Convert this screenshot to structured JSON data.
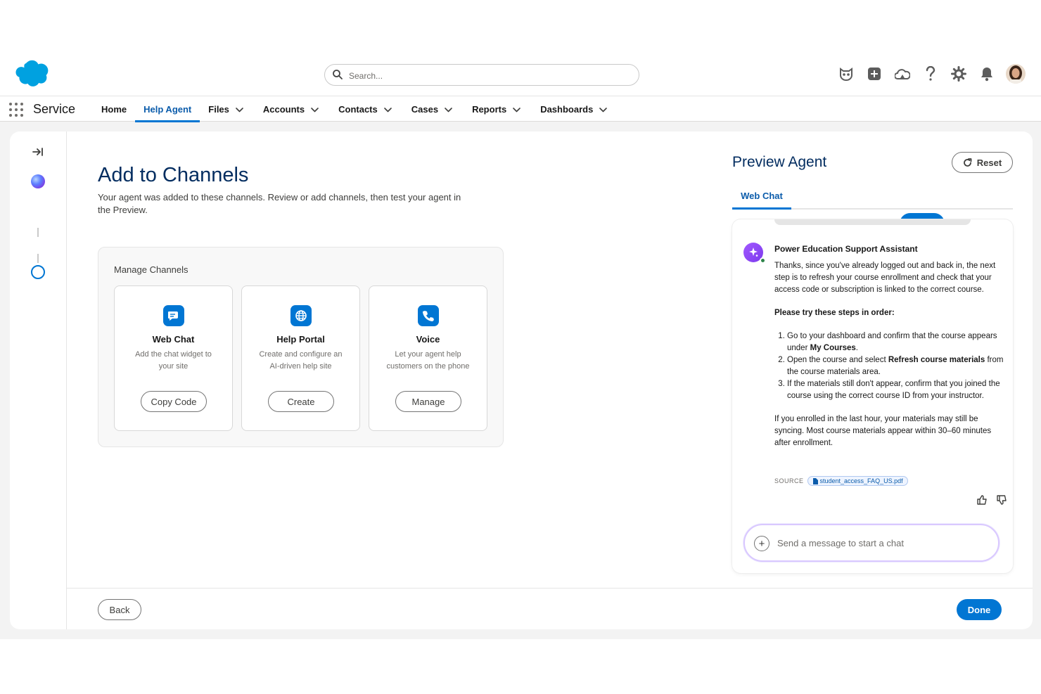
{
  "header": {
    "search_placeholder": "Search...",
    "icons": [
      "agentforce-icon",
      "add-icon",
      "trailhead-icon",
      "help-icon",
      "setup-gear-icon",
      "notifications-bell-icon",
      "user-avatar"
    ]
  },
  "nav": {
    "app_name": "Service",
    "items": [
      {
        "label": "Home",
        "dropdown": false,
        "active": false
      },
      {
        "label": "Help Agent",
        "dropdown": false,
        "active": true
      },
      {
        "label": "Files",
        "dropdown": true,
        "active": false
      },
      {
        "label": "Accounts",
        "dropdown": true,
        "active": false
      },
      {
        "label": "Contacts",
        "dropdown": true,
        "active": false
      },
      {
        "label": "Cases",
        "dropdown": true,
        "active": false
      },
      {
        "label": "Reports",
        "dropdown": true,
        "active": false
      },
      {
        "label": "Dashboards",
        "dropdown": true,
        "active": false
      }
    ]
  },
  "main": {
    "title": "Add to Channels",
    "description": "Your agent was added to these channels. Review or add channels, then test your agent in the Preview.",
    "manage_title": "Manage Channels",
    "channels": [
      {
        "name": "Web Chat",
        "description": "Add the chat widget to your site",
        "button": "Copy Code",
        "icon": "chat-icon"
      },
      {
        "name": "Help Portal",
        "description": "Create and configure an AI-driven help site",
        "button": "Create",
        "icon": "globe-icon"
      },
      {
        "name": "Voice",
        "description": "Let your agent help customers on the phone",
        "button": "Manage",
        "icon": "phone-icon"
      }
    ]
  },
  "steps": [
    {
      "state": "done"
    },
    {
      "state": "done"
    },
    {
      "state": "todo"
    }
  ],
  "preview": {
    "title": "Preview Agent",
    "reset_label": "Reset",
    "tab": "Web Chat",
    "bot_name": "Power Education Support Assistant",
    "msg_intro": "Thanks, since you've already logged out and back in, the next step is to refresh your course enrollment and check that your access code or subscription is linked to the correct course.",
    "steps_heading": "Please try these steps in order:",
    "step1_a": "Go to your dashboard and confirm that the course appears under ",
    "step1_b": "My Courses",
    "step1_c": ".",
    "step2_a": "Open the course and select ",
    "step2_b": "Refresh course materials",
    "step2_c": " from the course materials area.",
    "step3": "If the materials still don't appear, confirm that you joined the course using the correct course ID from your instructor.",
    "msg_outro": "If you enrolled in the last hour, your materials may still be syncing. Most course materials appear within 30–60 minutes after enrollment.",
    "source_label": "SOURCE",
    "source_file": "student_access_FAQ_US.pdf",
    "composer_placeholder": "Send a message to start a chat"
  },
  "footer": {
    "back_label": "Back",
    "done_label": "Done"
  },
  "colors": {
    "brand_blue": "#0176d3",
    "title_navy": "#032d60",
    "salesforce_cloud": "#00a1e0"
  }
}
